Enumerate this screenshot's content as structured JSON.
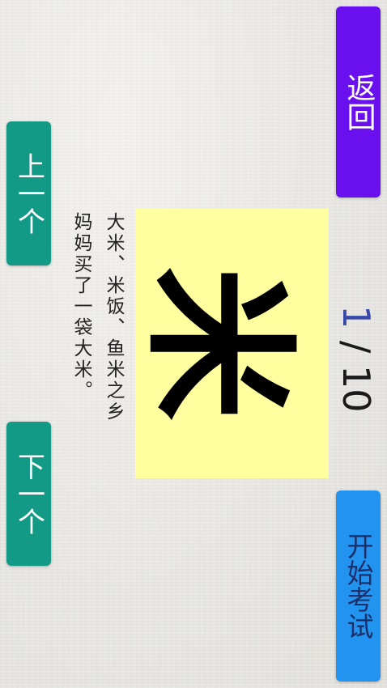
{
  "buttons": {
    "back": "返回",
    "start_exam": "开始考试",
    "previous": "上一个",
    "next": "下一个"
  },
  "counter": {
    "current": "1",
    "separator": "/",
    "total": "10"
  },
  "card": {
    "character": "米"
  },
  "example": {
    "line1": "大米、米饭、鱼米之乡",
    "line2": "妈妈买了一袋大米。"
  },
  "colors": {
    "back_button": "#6a10ee",
    "start_button": "#2294ef",
    "nav_buttons": "#139a87",
    "card_background": "#ffff9f",
    "counter_current": "#3949a8"
  }
}
